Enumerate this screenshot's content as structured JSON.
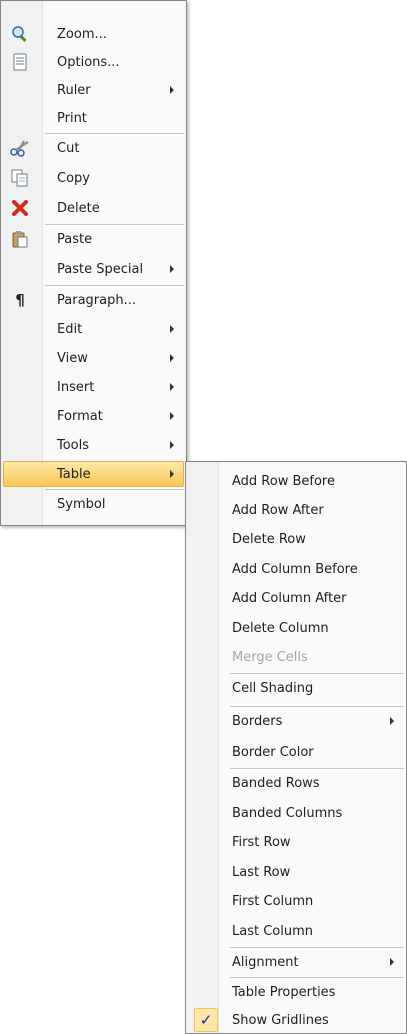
{
  "main_menu": {
    "items": [
      {
        "label": "Zoom...",
        "icon": "zoom-icon"
      },
      {
        "label": "Options...",
        "icon": "options-icon"
      },
      {
        "label": "Ruler",
        "submenu": true
      },
      {
        "label": "Print"
      },
      {
        "label": "Cut",
        "icon": "cut-icon",
        "separator": true
      },
      {
        "label": "Copy",
        "icon": "copy-icon"
      },
      {
        "label": "Delete",
        "icon": "delete-icon"
      },
      {
        "label": "Paste",
        "icon": "paste-icon",
        "separator": true
      },
      {
        "label": "Paste Special",
        "submenu": true
      },
      {
        "label": "Paragraph...",
        "icon": "paragraph-icon",
        "separator": true
      },
      {
        "label": "Edit",
        "submenu": true
      },
      {
        "label": "View",
        "submenu": true
      },
      {
        "label": "Insert",
        "submenu": true
      },
      {
        "label": "Format",
        "submenu": true
      },
      {
        "label": "Tools",
        "submenu": true
      },
      {
        "label": "Table",
        "submenu": true,
        "highlighted": true
      },
      {
        "label": "Symbol",
        "separator": true
      }
    ]
  },
  "table_submenu": {
    "items": [
      {
        "label": "Add Row Before"
      },
      {
        "label": "Add Row After"
      },
      {
        "label": "Delete Row"
      },
      {
        "label": "Add Column Before"
      },
      {
        "label": "Add Column After"
      },
      {
        "label": "Delete Column"
      },
      {
        "label": "Merge Cells",
        "disabled": true
      },
      {
        "label": "Cell Shading",
        "separator": true
      },
      {
        "label": "Borders",
        "submenu": true,
        "separator": true
      },
      {
        "label": "Border Color"
      },
      {
        "label": "Banded Rows",
        "separator": true
      },
      {
        "label": "Banded Columns"
      },
      {
        "label": "First Row"
      },
      {
        "label": "Last Row"
      },
      {
        "label": "First Column"
      },
      {
        "label": "Last Column"
      },
      {
        "label": "Alignment",
        "submenu": true,
        "separator": true
      },
      {
        "label": "Table Properties",
        "separator": true
      },
      {
        "label": "Show Gridlines",
        "checked": true
      }
    ]
  },
  "colors": {
    "highlight": "#f9c658",
    "menu_bg": "#fafafa",
    "gutter": "#f1f1f1",
    "disabled_text": "#a6a6a6"
  }
}
